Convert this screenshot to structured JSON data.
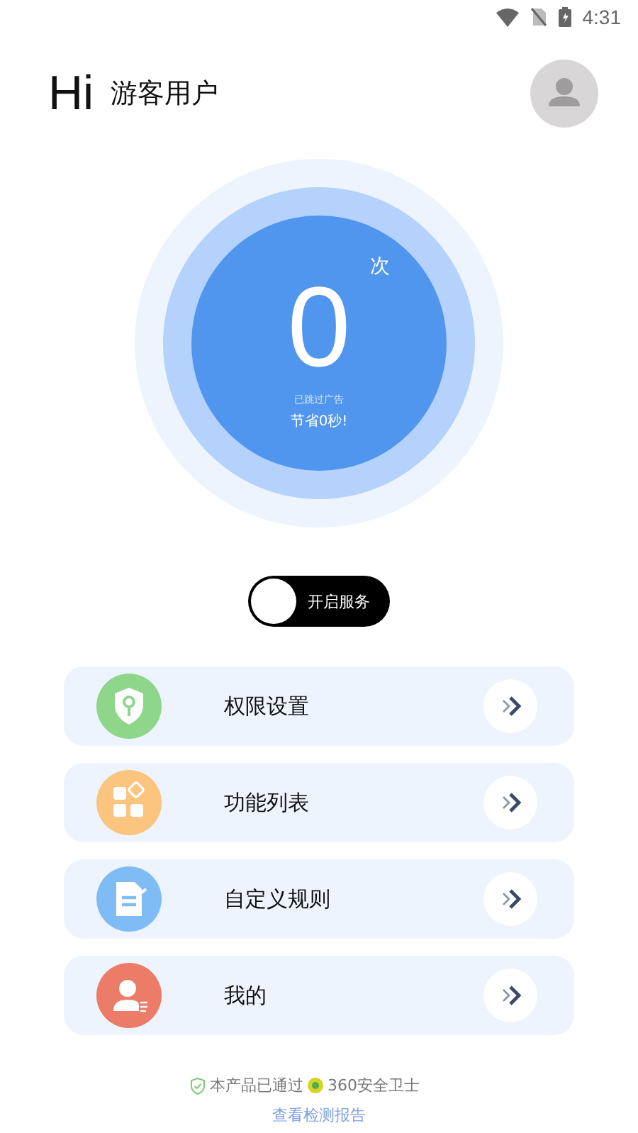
{
  "status_bar": {
    "time": "4:31"
  },
  "header": {
    "greeting": "Hi",
    "user_name": "游客用户"
  },
  "counter": {
    "count": "0",
    "unit": "次",
    "caption": "已跳过广告",
    "saved": "节省0秒!"
  },
  "service_toggle": {
    "label": "开启服务",
    "on": false
  },
  "menu": [
    {
      "label": "权限设置",
      "kind": "shield",
      "color": "#8dd68a"
    },
    {
      "label": "功能列表",
      "kind": "grid",
      "color": "#fbc47f"
    },
    {
      "label": "自定义规则",
      "kind": "note",
      "color": "#7fbcf6"
    },
    {
      "label": "我的",
      "kind": "person",
      "color": "#ec7c68"
    }
  ],
  "footer": {
    "certified": "本产品已通过",
    "vendor": "360安全卫士",
    "report_link": "查看检测报告"
  }
}
